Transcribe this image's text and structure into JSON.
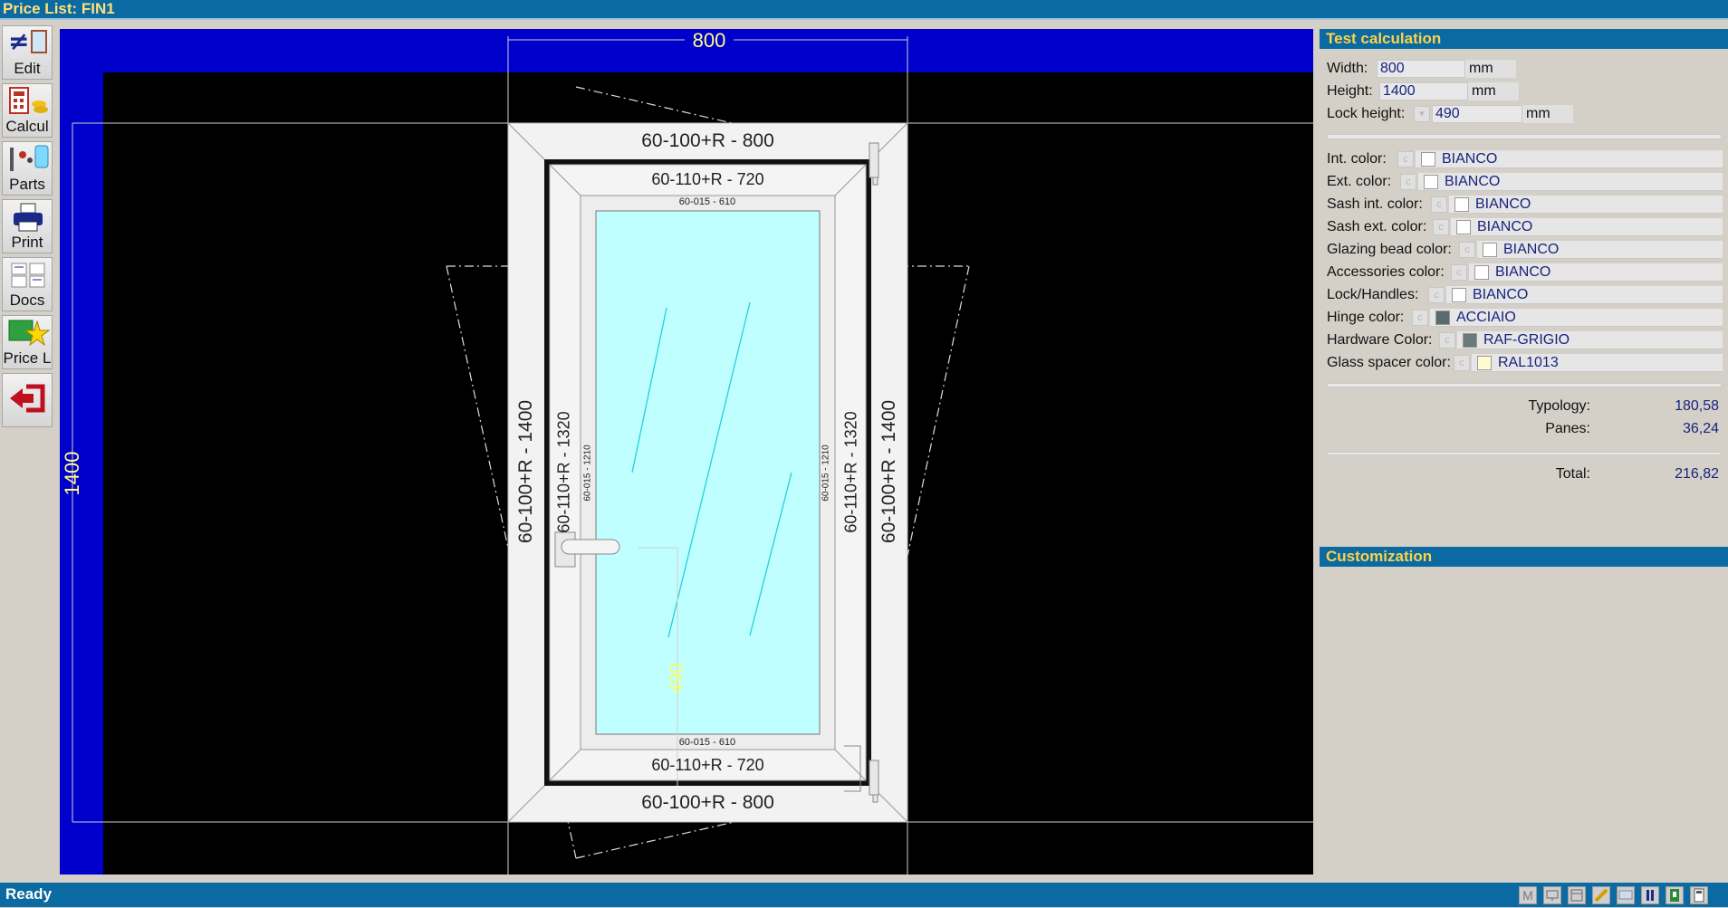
{
  "window": {
    "title": "Price List: FIN1"
  },
  "toolbar": {
    "items": [
      {
        "label": "Edit"
      },
      {
        "label": "Calcul"
      },
      {
        "label": "Parts"
      },
      {
        "label": "Print"
      },
      {
        "label": "Docs"
      },
      {
        "label": "Price L"
      },
      {
        "label": ""
      }
    ]
  },
  "drawing": {
    "overall_width": "800",
    "overall_height": "1400",
    "lock_dim": "490",
    "frame_top": "60-100+R - 800",
    "frame_bottom": "60-100+R - 800",
    "frame_left": "60-100+R - 1400",
    "frame_right": "60-100+R - 1400",
    "sash_top": "60-110+R - 720",
    "sash_bottom": "60-110+R - 720",
    "sash_left": "60-110+R - 1320",
    "sash_right": "60-110+R - 1320",
    "bead_top": "60-015 - 610",
    "bead_bottom": "60-015 - 610",
    "bead_left": "60-015 - 1210",
    "bead_right": "60-015 - 1210",
    "colors": {
      "background": "#000000",
      "frame_band": "#0000cc",
      "glass": "#c0ffff",
      "line": "#ffffff"
    }
  },
  "test_calculation": {
    "title": "Test calculation",
    "width": {
      "label": "Width:",
      "value": "800",
      "unit": "mm"
    },
    "height": {
      "label": "Height:",
      "value": "1400",
      "unit": "mm"
    },
    "lock_height": {
      "label": "Lock height:",
      "value": "490",
      "unit": "mm"
    },
    "colors": [
      {
        "label": "Int. color:",
        "value": "BIANCO",
        "swatch": "#ffffff"
      },
      {
        "label": "Ext. color:",
        "value": "BIANCO",
        "swatch": "#ffffff"
      },
      {
        "label": "Sash int. color:",
        "value": "BIANCO",
        "swatch": "#ffffff"
      },
      {
        "label": "Sash ext. color:",
        "value": "BIANCO",
        "swatch": "#ffffff"
      },
      {
        "label": "Glazing bead color:",
        "value": "BIANCO",
        "swatch": "#ffffff"
      },
      {
        "label": "Accessories color:",
        "value": "BIANCO",
        "swatch": "#ffffff"
      },
      {
        "label": "Lock/Handles:",
        "value": "BIANCO",
        "swatch": "#ffffff"
      },
      {
        "label": "Hinge color:",
        "value": "ACCIAIO",
        "swatch": "#5a6b6e"
      },
      {
        "label": "Hardware Color:",
        "value": "RAF-GRIGIO",
        "swatch": "#6a7a7a"
      },
      {
        "label": "Glass spacer color:",
        "value": "RAL1013",
        "swatch": "#fffbd0"
      }
    ],
    "c_button": "c",
    "typology": {
      "label": "Typology:",
      "value": "180,58"
    },
    "panes": {
      "label": "Panes:",
      "value": "36,24"
    },
    "total": {
      "label": "Total:",
      "value": "216,82"
    }
  },
  "customization": {
    "title": "Customization"
  },
  "status": {
    "text": "Ready"
  },
  "tray": [
    {
      "icon": "m-icon",
      "label": "M"
    },
    {
      "icon": "monitor-icon"
    },
    {
      "icon": "window-icon"
    },
    {
      "icon": "pencil-icon"
    },
    {
      "icon": "display-icon"
    },
    {
      "icon": "pause-icon"
    },
    {
      "icon": "book-icon"
    },
    {
      "icon": "calculator-icon"
    }
  ]
}
